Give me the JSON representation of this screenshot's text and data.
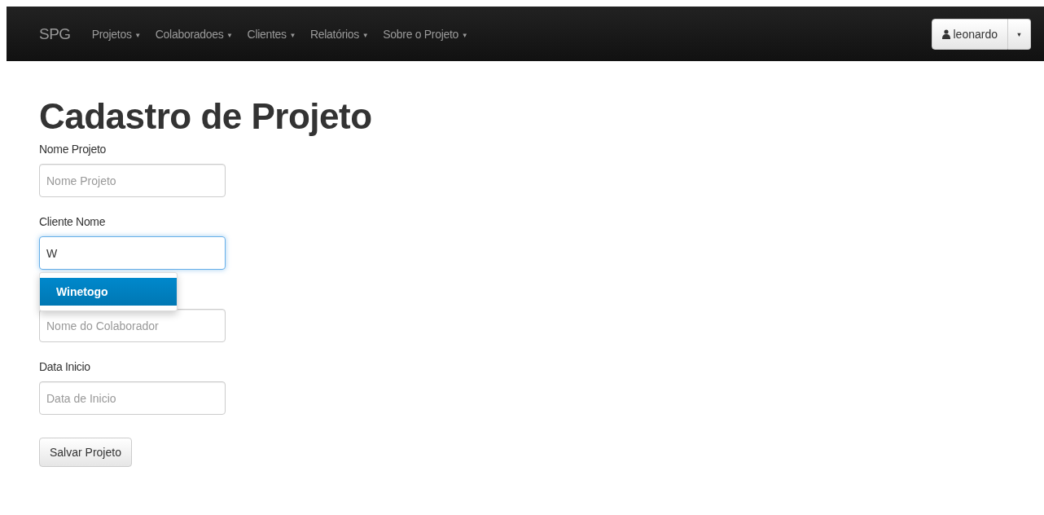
{
  "navbar": {
    "brand": "SPG",
    "menus": [
      {
        "label": "Projetos",
        "caret": "▼"
      },
      {
        "label": "Colaboradoes",
        "caret": "▼"
      },
      {
        "label": "Clientes",
        "caret": "▼"
      },
      {
        "label": "Relatórios",
        "caret": "▼"
      },
      {
        "label": "Sobre o Projeto",
        "caret": "▼"
      }
    ],
    "user": {
      "name": "leonardo",
      "caret": "▼"
    }
  },
  "heading": "Cadastro de Projeto",
  "fields": [
    {
      "label": "Nome Projeto",
      "placeholder": "Nome Projeto",
      "focused": false
    },
    {
      "label": "Cliente Nome",
      "value": "W",
      "focused": true,
      "suggestions": [
        {
          "label": "Winetogo",
          "selected": true
        }
      ]
    },
    {
      "placeholder": "Nome do Colaborador",
      "focused": false
    },
    {
      "label": "Data Inicio",
      "placeholder": "Data de Inicio",
      "focused": false
    }
  ],
  "submit": "Salvar Projeto"
}
